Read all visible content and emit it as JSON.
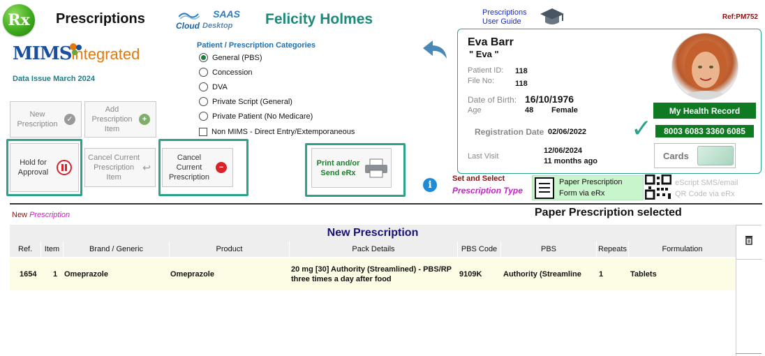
{
  "header": {
    "logo_text": "Rx",
    "app_title": "Prescriptions",
    "saas_top": "SAAS",
    "saas_cloud": "Cloud",
    "saas_desktop": "Desktop",
    "user_name": "Felicity Holmes",
    "guide_line1": "Prescriptions",
    "guide_line2": "User Guide",
    "ref": "Ref:PM752"
  },
  "mims": {
    "logo_main": "MIMS",
    "logo_integrated": "integrated",
    "data_issue": "Data Issue   March 2024"
  },
  "categories": {
    "title": "Patient / Prescription Categories",
    "options": [
      {
        "label": "General (PBS)",
        "selected": true
      },
      {
        "label": "Concession",
        "selected": false
      },
      {
        "label": "DVA",
        "selected": false
      },
      {
        "label": "Private Script (General)",
        "selected": false
      },
      {
        "label": "Private Patient (No Medicare)",
        "selected": false
      }
    ],
    "non_mims_label": "Non MIMS - Direct Entry/Extemporaneous"
  },
  "actions": {
    "new_prescription": "New Prescription",
    "add_item": "Add Prescription Item",
    "hold_for_approval": "Hold for Approval",
    "cancel_item": "Cancel Current Prescription Item",
    "cancel_prescription": "Cancel Current Prescription",
    "print_send": "Print and/or Send eRx"
  },
  "patient": {
    "name": "Eva Barr",
    "nickname": "\" Eva \"",
    "patient_id_label": "Patient ID:",
    "patient_id": "118",
    "file_no_label": "File No:",
    "file_no": "118",
    "dob_label": "Date of Birth:",
    "dob": "16/10/1976",
    "age_label": "Age",
    "age": "48",
    "sex": "Female",
    "reg_label": "Registration Date",
    "reg_date": "02/06/2022",
    "last_visit_label": "Last Visit",
    "last_visit_date": "12/06/2024",
    "last_visit_ago": "11 months ago",
    "my_health_record": "My Health Record",
    "medicare_number": "8003 6083 3360 6085",
    "cards_label": "Cards"
  },
  "prescription_type": {
    "set_select": "Set and Select",
    "type_label": "Prescription Type",
    "paper_line1": "Paper Prescription",
    "paper_line2": "Form via eRx",
    "escript_line1": "eScript SMS/email",
    "escript_line2": "QR Code via eRx"
  },
  "status": {
    "new_label": "New",
    "new_label_italic": "Prescription",
    "paper_selected": "Paper Prescription selected"
  },
  "table": {
    "title": "New Prescription",
    "columns": [
      "Ref.",
      "Item",
      "Brand / Generic",
      "Product",
      "Pack Details",
      "PBS Code",
      "PBS",
      "Repeats",
      "Formulation"
    ],
    "rows": [
      {
        "ref": "1654",
        "item": "1",
        "brand": "Omeprazole",
        "product": "Omeprazole",
        "pack_line1": "20 mg [30] Authority (Streamlined) - PBS/RP",
        "pack_line2": "three times a day after food",
        "pbs_code": "9109K",
        "pbs": "Authority (Streamline",
        "repeats": "1",
        "formulation": "Tablets"
      }
    ]
  },
  "colors": {
    "accent_teal": "#2aa38a",
    "title_green": "#1a8a7a",
    "record_green": "#0e7a22",
    "ref_red": "#8a1010",
    "magenta": "#c81fc8"
  }
}
